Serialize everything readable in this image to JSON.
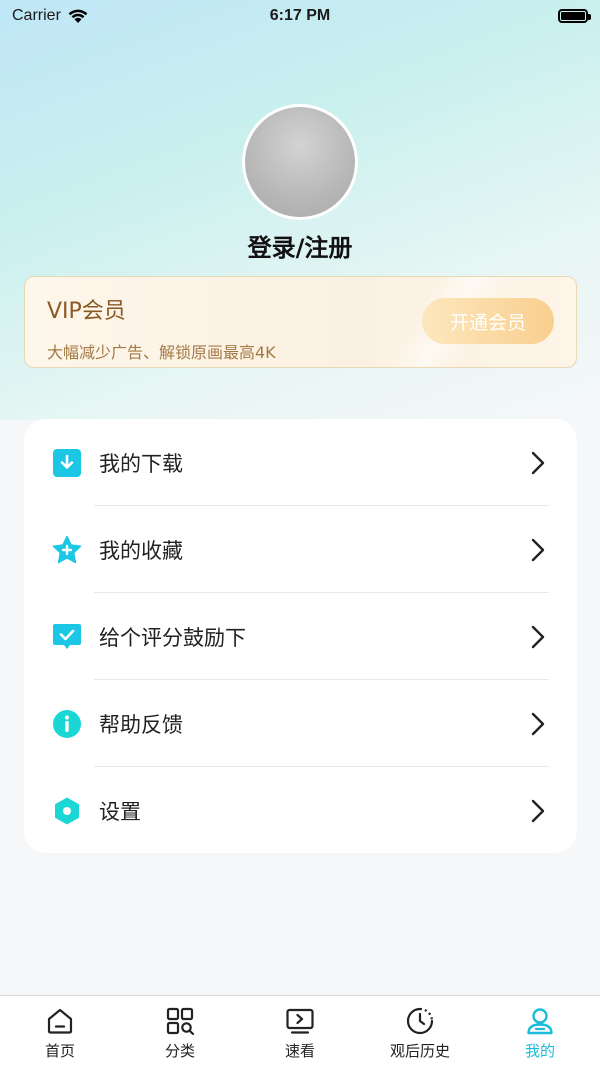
{
  "status_bar": {
    "carrier": "Carrier",
    "time": "6:17 PM"
  },
  "profile": {
    "login_label": "登录/注册"
  },
  "vip": {
    "title": "VIP会员",
    "subtitle": "大幅减少广告、解锁原画最高4K",
    "button_label": "开通会员"
  },
  "menu": {
    "items": [
      {
        "label": "我的下载",
        "icon": "download-icon"
      },
      {
        "label": "我的收藏",
        "icon": "star-icon"
      },
      {
        "label": "给个评分鼓励下",
        "icon": "rating-icon"
      },
      {
        "label": "帮助反馈",
        "icon": "info-icon"
      },
      {
        "label": "设置",
        "icon": "settings-icon"
      }
    ]
  },
  "tabbar": {
    "tabs": [
      {
        "label": "首页",
        "icon": "home-icon"
      },
      {
        "label": "分类",
        "icon": "category-icon"
      },
      {
        "label": "速看",
        "icon": "play-icon"
      },
      {
        "label": "观后历史",
        "icon": "history-icon"
      },
      {
        "label": "我的",
        "icon": "user-icon",
        "active": true
      }
    ]
  },
  "colors": {
    "accent": "#1bbcd8",
    "icon_cyan": "#1cc7e6",
    "vip_text": "#8a5a24"
  }
}
